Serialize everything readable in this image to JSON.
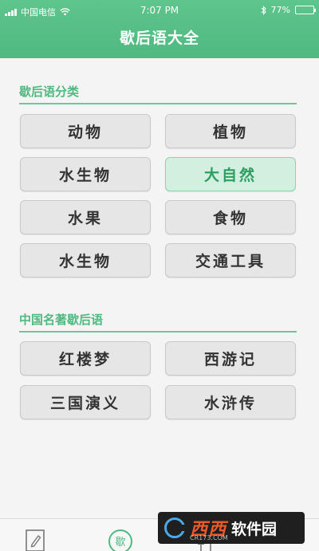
{
  "status": {
    "carrier": "中国电信",
    "time": "7:07 PM",
    "battery": "77%",
    "battery_level": 0.77
  },
  "header": {
    "title": "歇后语大全"
  },
  "sections": [
    {
      "title": "歇后语分类",
      "items": [
        {
          "label": "动物",
          "active": false
        },
        {
          "label": "植物",
          "active": false
        },
        {
          "label": "水生物",
          "active": false
        },
        {
          "label": "大自然",
          "active": true
        },
        {
          "label": "水果",
          "active": false
        },
        {
          "label": "食物",
          "active": false
        },
        {
          "label": "水生物",
          "active": false
        },
        {
          "label": "交通工具",
          "active": false
        }
      ]
    },
    {
      "title": "中国名著歇后语",
      "items": [
        {
          "label": "红楼梦",
          "active": false
        },
        {
          "label": "西游记",
          "active": false
        },
        {
          "label": "三国演义",
          "active": false
        },
        {
          "label": "水浒传",
          "active": false
        }
      ]
    }
  ],
  "tabbar": {
    "tabs": [
      {
        "icon": "edit-icon"
      },
      {
        "icon": "xie-circle-icon",
        "label": "歇"
      },
      {
        "icon": "sliders-icon"
      },
      {
        "icon": "user-icon"
      }
    ]
  },
  "watermark": {
    "text1": "西西",
    "text2": "软件园",
    "sub": "CR173.COM"
  },
  "colors": {
    "accent": "#4fb980",
    "active_bg": "#d2efdf",
    "active_text": "#2d9f62"
  }
}
